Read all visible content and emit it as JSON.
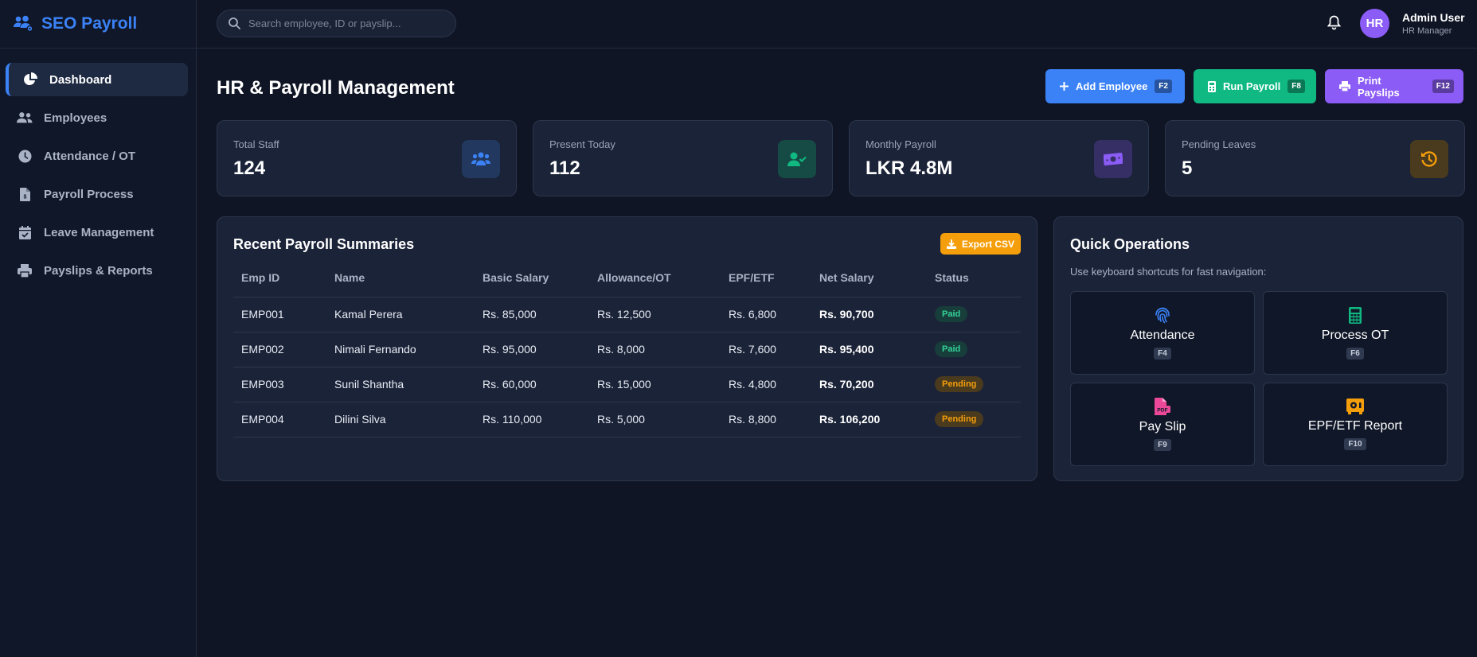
{
  "app": {
    "name": "SEO Payroll"
  },
  "sidebar": {
    "items": [
      {
        "label": "Dashboard",
        "icon": "pie-chart-icon",
        "active": true
      },
      {
        "label": "Employees",
        "icon": "users-icon"
      },
      {
        "label": "Attendance / OT",
        "icon": "clock-icon"
      },
      {
        "label": "Payroll Process",
        "icon": "invoice-icon"
      },
      {
        "label": "Leave Management",
        "icon": "calendar-check-icon"
      },
      {
        "label": "Payslips & Reports",
        "icon": "printer-icon"
      }
    ]
  },
  "topbar": {
    "search_placeholder": "Search employee, ID or payslip...",
    "user": {
      "initials": "HR",
      "name": "Admin User",
      "role": "HR Manager"
    }
  },
  "page": {
    "title": "HR & Payroll Management"
  },
  "actions": [
    {
      "label": "Add Employee",
      "shortcut": "F2",
      "color": "#3b82f6"
    },
    {
      "label": "Run Payroll",
      "shortcut": "F8",
      "color": "#10b981"
    },
    {
      "label": "Print Payslips",
      "shortcut": "F12",
      "color": "#8b5cf6"
    }
  ],
  "stats": [
    {
      "label": "Total Staff",
      "value": "124",
      "icon": "users-icon",
      "color": "#3b82f6"
    },
    {
      "label": "Present Today",
      "value": "112",
      "icon": "user-check-icon",
      "color": "#10b981"
    },
    {
      "label": "Monthly Payroll",
      "value": "LKR 4.8M",
      "icon": "money-icon",
      "color": "#8b5cf6"
    },
    {
      "label": "Pending Leaves",
      "value": "5",
      "icon": "history-icon",
      "color": "#f59e0b"
    }
  ],
  "payroll": {
    "title": "Recent Payroll Summaries",
    "export_label": "Export CSV",
    "columns": [
      "Emp ID",
      "Name",
      "Basic Salary",
      "Allowance/OT",
      "EPF/ETF",
      "Net Salary",
      "Status"
    ],
    "rows": [
      {
        "id": "EMP001",
        "name": "Kamal Perera",
        "basic": "Rs. 85,000",
        "allowance": "Rs. 12,500",
        "epf": "Rs. 6,800",
        "net": "Rs. 90,700",
        "status": "Paid"
      },
      {
        "id": "EMP002",
        "name": "Nimali Fernando",
        "basic": "Rs. 95,000",
        "allowance": "Rs. 8,000",
        "epf": "Rs. 7,600",
        "net": "Rs. 95,400",
        "status": "Paid"
      },
      {
        "id": "EMP003",
        "name": "Sunil Shantha",
        "basic": "Rs. 60,000",
        "allowance": "Rs. 15,000",
        "epf": "Rs. 4,800",
        "net": "Rs. 70,200",
        "status": "Pending"
      },
      {
        "id": "EMP004",
        "name": "Dilini Silva",
        "basic": "Rs. 110,000",
        "allowance": "Rs. 5,000",
        "epf": "Rs. 8,800",
        "net": "Rs. 106,200",
        "status": "Pending"
      }
    ]
  },
  "quick_ops": {
    "title": "Quick Operations",
    "subtitle": "Use keyboard shortcuts for fast navigation:",
    "items": [
      {
        "label": "Attendance",
        "shortcut": "F4",
        "icon": "fingerprint-icon",
        "color": "#3b82f6"
      },
      {
        "label": "Process OT",
        "shortcut": "F6",
        "icon": "calculator-icon",
        "color": "#10b981"
      },
      {
        "label": "Pay Slip",
        "shortcut": "F9",
        "icon": "pdf-file-icon",
        "color": "#ec4899"
      },
      {
        "label": "EPF/ETF Report",
        "shortcut": "F10",
        "icon": "safe-icon",
        "color": "#f59e0b"
      }
    ]
  }
}
